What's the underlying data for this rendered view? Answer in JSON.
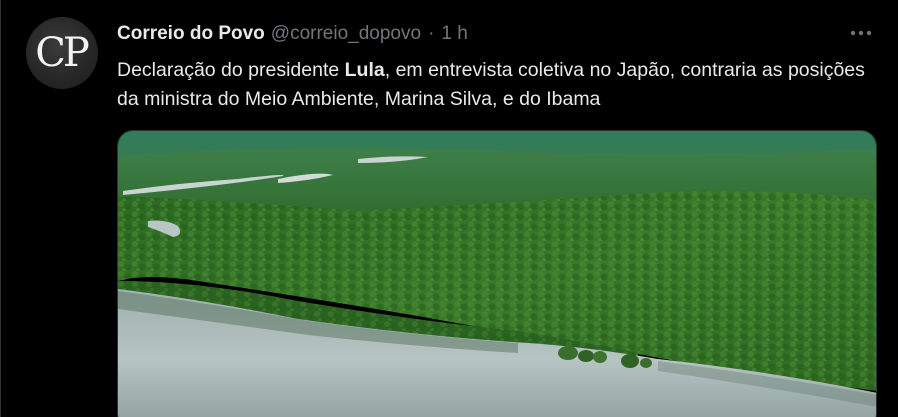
{
  "author": {
    "display_name": "Correio do Povo",
    "handle": "@correio_dopovo",
    "separator": "·",
    "time": "1 h",
    "avatar_text": "CP"
  },
  "tweet": {
    "text_before": "Declaração do presidente ",
    "text_bold": "Lula",
    "text_after": ", em entrevista coletiva no Japão, contraria as posições da ministra do Meio Ambiente, Marina Silva, e do Ibama"
  },
  "media": {
    "icon": "aerial-photo-amazon-forest-river"
  },
  "colors": {
    "background": "#000000",
    "primary_text": "#e7e9ea",
    "secondary_text": "#71767b",
    "border": "#2f3336"
  }
}
